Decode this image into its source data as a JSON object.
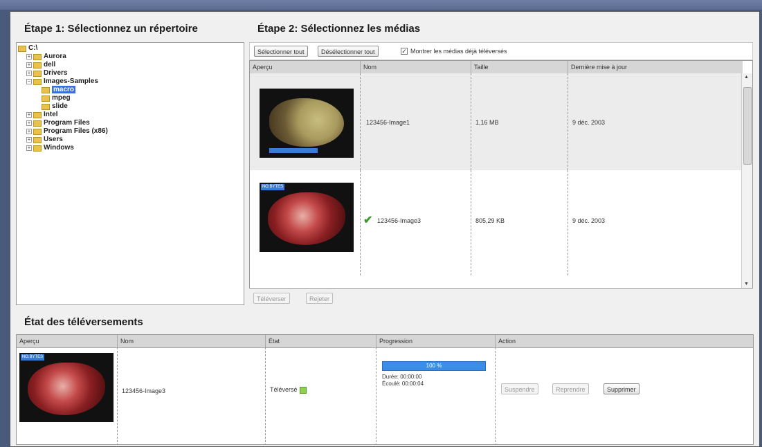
{
  "step1": {
    "title": "Étape 1: Sélectionnez un répertoire",
    "tree": [
      {
        "label": "C:\\",
        "level": 0,
        "expander": "",
        "selected": false
      },
      {
        "label": "Aurora",
        "level": 1,
        "expander": "+",
        "selected": false
      },
      {
        "label": "dell",
        "level": 1,
        "expander": "+",
        "selected": false
      },
      {
        "label": "Drivers",
        "level": 1,
        "expander": "+",
        "selected": false
      },
      {
        "label": "Images-Samples",
        "level": 1,
        "expander": "−",
        "selected": false
      },
      {
        "label": "macro",
        "level": 2,
        "expander": "",
        "selected": true
      },
      {
        "label": "mpeg",
        "level": 2,
        "expander": "",
        "selected": false
      },
      {
        "label": "slide",
        "level": 2,
        "expander": "",
        "selected": false
      },
      {
        "label": "Intel",
        "level": 1,
        "expander": "+",
        "selected": false
      },
      {
        "label": "Program Files",
        "level": 1,
        "expander": "+",
        "selected": false
      },
      {
        "label": "Program Files (x86)",
        "level": 1,
        "expander": "+",
        "selected": false
      },
      {
        "label": "Users",
        "level": 1,
        "expander": "+",
        "selected": false
      },
      {
        "label": "Windows",
        "level": 1,
        "expander": "+",
        "selected": false
      }
    ]
  },
  "step2": {
    "title": "Étape 2: Sélectionnez les médias",
    "select_all": "Sélectionner tout",
    "deselect_all": "Désélectionner tout",
    "show_uploaded_checked": true,
    "show_uploaded_label": "Montrer les médias déjà téléversés",
    "columns": [
      "Aperçu",
      "Nom",
      "Taille",
      "Dernière mise à jour"
    ],
    "rows": [
      {
        "name": "123456-Image1",
        "size": "1,16 MB",
        "updated": "9 déc. 2003",
        "uploaded": false
      },
      {
        "name": "123456-Image3",
        "size": "805,29 KB",
        "updated": "9 déc. 2003",
        "uploaded": true
      }
    ],
    "upload_button": "Téléverser",
    "reject_button": "Rejeter",
    "thumb_tag": "NO.BYTES"
  },
  "uploads": {
    "title": "État des téléversements",
    "columns": [
      "Aperçu",
      "Nom",
      "État",
      "Progression",
      "Action"
    ],
    "row": {
      "name": "123456-Image3",
      "status": "Téléversé",
      "progress_text": "100 %",
      "progress_value": 1.0,
      "duration": "Durée: 00:00:00",
      "elapsed": "Écoulé: 00:00:04",
      "suspend": "Suspendre",
      "resume": "Reprendre",
      "delete": "Supprimer"
    }
  },
  "colors": {
    "accent": "#3a8ee8",
    "selection": "#3a6fd8",
    "status_ok": "#8fd14f",
    "check": "#3a9a2a"
  }
}
